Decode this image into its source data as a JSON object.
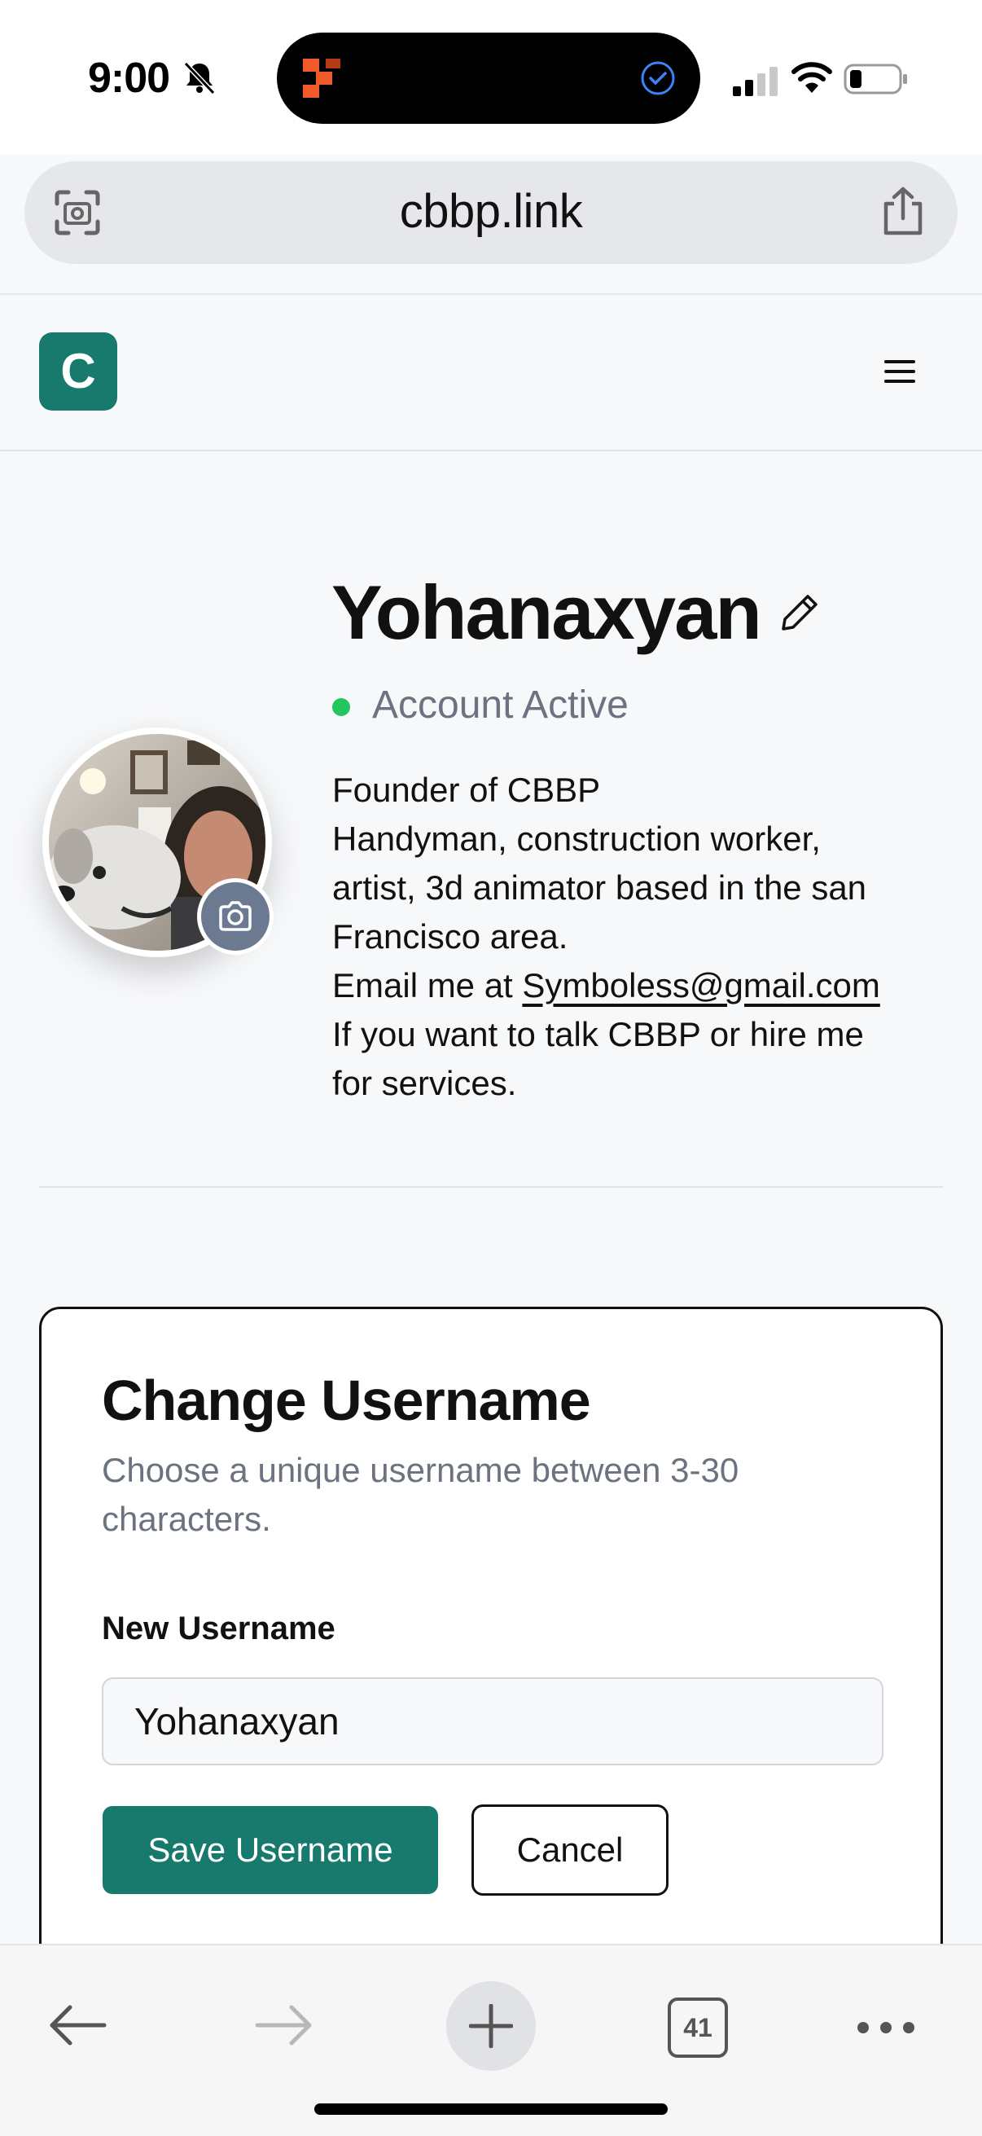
{
  "status_bar": {
    "time": "9:00",
    "icons": [
      "bell-muted-icon",
      "island-app-icon",
      "island-check-icon",
      "signal-icon",
      "wifi-icon",
      "battery-icon"
    ]
  },
  "browser": {
    "url": "cbbp.link",
    "icons": [
      "scan-icon",
      "share-icon"
    ],
    "tab_count": "41"
  },
  "header": {
    "logo_letter": "C",
    "brand_color": "#177a6c",
    "icons": [
      "menu-icon"
    ]
  },
  "profile": {
    "username": "Yohanaxyan",
    "status": "Account Active",
    "status_color": "#22c55e",
    "bio": {
      "line1": "Founder of CBBP",
      "line2": "Handyman, construction worker,",
      "line3": "artist, 3d animator based in the san",
      "line4": "Francisco area.",
      "email_prefix": "Email me at ",
      "email": "Symboless@gmail.com",
      "line6": "If you want to talk CBBP or hire me",
      "line7": "for services."
    },
    "icons": [
      "edit-icon",
      "camera-icon"
    ]
  },
  "change_username": {
    "title": "Change Username",
    "subtitle": "Choose a unique username between 3-30 characters.",
    "field_label": "New Username",
    "field_value": "Yohanaxyan",
    "save_label": "Save Username",
    "cancel_label": "Cancel"
  },
  "toolbar": {
    "icons": [
      "back-icon",
      "forward-icon",
      "plus-icon",
      "tabs-icon",
      "more-icon"
    ]
  }
}
